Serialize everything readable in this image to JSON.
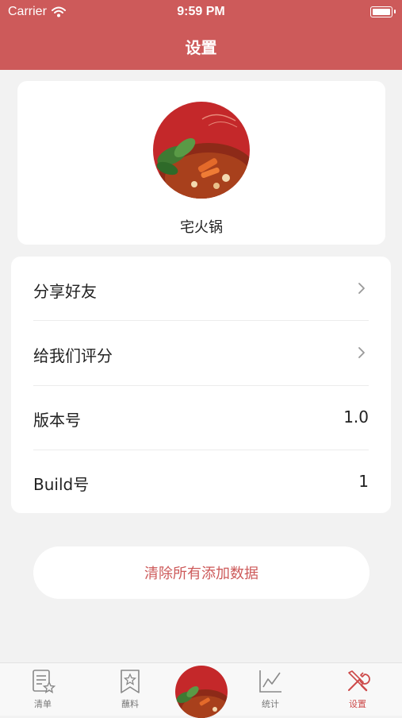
{
  "status_bar": {
    "carrier": "Carrier",
    "time": "9:59 PM"
  },
  "nav": {
    "title": "设置"
  },
  "profile": {
    "app_name": "宅火锅"
  },
  "menu": {
    "share": "分享好友",
    "rate": "给我们评分",
    "version_label": "版本号",
    "version_value": "1.0",
    "build_label": "Build号",
    "build_value": "1"
  },
  "actions": {
    "clear_all": "清除所有添加数据"
  },
  "tabs": [
    {
      "label": "清单",
      "icon": "list-icon"
    },
    {
      "label": "蘸料",
      "icon": "bookmark-star-icon"
    },
    {
      "label": "",
      "icon": "hotpot-center-icon"
    },
    {
      "label": "统计",
      "icon": "chart-icon"
    },
    {
      "label": "设置",
      "icon": "tools-icon"
    }
  ],
  "colors": {
    "accent": "#cd5a5a",
    "background": "#f2f2f2"
  }
}
